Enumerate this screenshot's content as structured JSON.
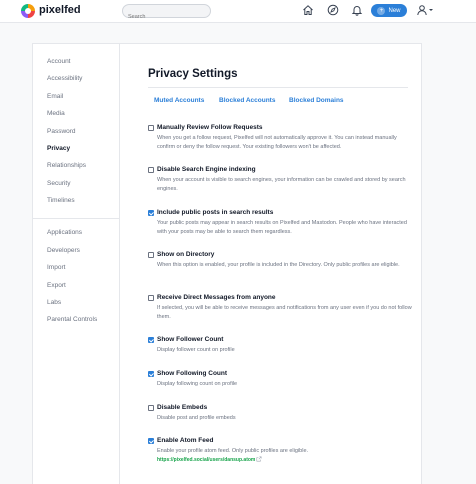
{
  "brand": {
    "name": "pixelfed"
  },
  "search": {
    "placeholder": "Search"
  },
  "nav": {
    "icons": [
      "home-icon",
      "compass-icon",
      "bell-icon"
    ],
    "new_label": "New"
  },
  "colors": {
    "accent": "#2b7fd8",
    "link_green": "#16a34a"
  },
  "sidebar": {
    "items": [
      "Account",
      "Accessibility",
      "Email",
      "Media",
      "Password",
      "Privacy",
      "Relationships",
      "Security",
      "Timelines"
    ],
    "items2": [
      "Applications",
      "Developers",
      "Import",
      "Export",
      "Labs",
      "Parental Controls"
    ],
    "active": "Privacy"
  },
  "page": {
    "title": "Privacy Settings"
  },
  "tabs": [
    "Muted Accounts",
    "Blocked Accounts",
    "Blocked Domains"
  ],
  "options": [
    {
      "label": "Manually Review Follow Requests",
      "checked": false,
      "help": "When you get a follow request, Pixelfed will not automatically approve it. You can instead manually confirm or deny the follow request. Your existing followers won't be affected."
    },
    {
      "label": "Disable Search Engine indexing",
      "checked": false,
      "help": "When your account is visible to search engines, your information can be crawled and stored by search engines."
    },
    {
      "label": "Include public posts in search results",
      "checked": true,
      "help": "Your public posts may appear in search results on Pixelfed and Mastodon. People who have interacted with your posts may be able to search them regardless."
    },
    {
      "label": "Show on Directory",
      "checked": false,
      "help": "When this option is enabled, your profile is included in the Directory. Only public profiles are eligible."
    },
    {
      "label": "Receive Direct Messages from anyone",
      "checked": false,
      "help": "If selected, you will be able to receive messages and notifications from any user even if you do not follow them."
    },
    {
      "label": "Show Follower Count",
      "checked": true,
      "help": "Display follower count on profile"
    },
    {
      "label": "Show Following Count",
      "checked": true,
      "help": "Display following count on profile"
    },
    {
      "label": "Disable Embeds",
      "checked": false,
      "help": "Disable post and profile embeds"
    },
    {
      "label": "Enable Atom Feed",
      "checked": true,
      "help": "Enable your profile atom feed. Only public profiles are eligible.",
      "link": "https://pixelfed.social/users/dansup.atom"
    }
  ]
}
